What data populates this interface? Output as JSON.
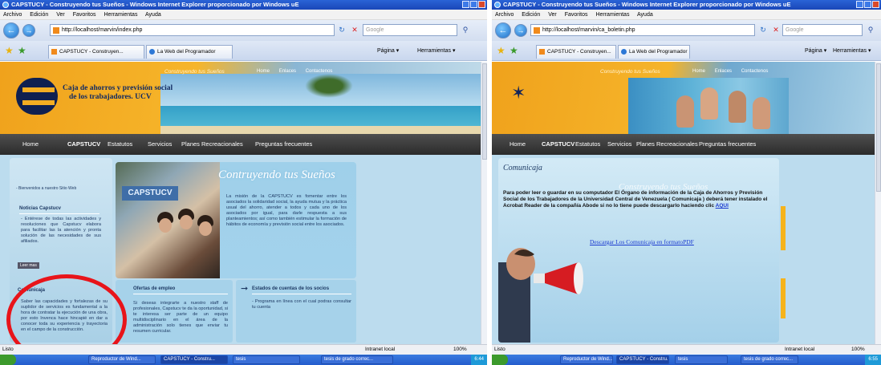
{
  "left": {
    "title": "CAPSTUCY - Construyendo tus Sueños - Windows Internet Explorer proporcionado por Windows uE",
    "menu": [
      "Archivo",
      "Edición",
      "Ver",
      "Favoritos",
      "Herramientas",
      "Ayuda"
    ],
    "address": "http://localhost/marvin/index.php",
    "search_placeholder": "Google",
    "tabs": [
      "CAPSTUCY - Construyen...",
      "La Web del Programador"
    ],
    "tools": [
      "Página ▾",
      "Herramientas ▾"
    ],
    "page": {
      "tagline": "Construyendo tus Sueños",
      "top_links": [
        "Home",
        "Enlaces",
        "Contactenos"
      ],
      "org_name_line1": "Caja de ahorros y previsión social",
      "org_name_line2": "de los trabajadores. UCV",
      "nav": [
        "Home",
        "CAPSTUCV",
        "Estatutos",
        "Servicios",
        "Planes Recreacionales",
        "Preguntas frecuentes"
      ],
      "welcome": "- Bienvenidos a nuestro Sitio Web",
      "news_title": "Noticias Capstucv",
      "news_text": "- Entérese de todas las actividades y resoluciones que Capstucv elabora para facilitar las la atención y pronta solución de las necesidades de sus afiliados.",
      "more": "Leer mas",
      "feature_title": "Contruyendo tus Sueños",
      "sign_text": "CAPSTUCV",
      "feature_text": "La misión de la CAPSTUCV es fomentar entre los asociados la solidaridad social, la ayuda mutua y la práctica usual del ahorro, atender a todos y cada uno de los asociados por igual, para darle respuesta a sus planteamientos; así como también estimular la formación de hábitos de economía y previsión social entre los asociados.",
      "comunicaja_title": "Comunicaja",
      "comunicaja_text": "Saber las capacidades y fortalezas de su suplidor de servicios es fundamental a la hora de contratar la ejecución de una obra, por esto Invenca hace hincapié en dar a conocer toda su experiencia y trayectoria en el campo de la construcción.",
      "ofertas_title": "Ofertas de empleo",
      "ofertas_text": "Si deseas integrarte a nuestro staff de profesionales, Capstucv te da la oportunidad, si te interesa ser parte de un equipo multidisciplinario en el área de la administración solo tienes que enviar tu resumen curricular.",
      "estados_title": "Estados de cuentas de los socios",
      "estados_text": "- Programa en línea con el cual podras consultar tu cuenta"
    },
    "status": "Listo",
    "zone": "Intranet local",
    "zoom": "100%",
    "taskbar": [
      "Reproductor de Wind...",
      "CAPSTUCY - Constru...",
      "tesis",
      "tesis de grado correc..."
    ],
    "clock": "6:44"
  },
  "right": {
    "title": "CAPSTUCY - Construyendo tus Sueños - Windows Internet Explorer proporcionado por Windows uE",
    "menu": [
      "Archivo",
      "Edición",
      "Ver",
      "Favoritos",
      "Herramientas",
      "Ayuda"
    ],
    "address": "http://localhost/marvin/ca_boletin.php",
    "search_placeholder": "Google",
    "tabs": [
      "CAPSTUCY - Construyen...",
      "La Web del Programador"
    ],
    "tools": [
      "Página ▾",
      "Herramientas ▾"
    ],
    "page": {
      "tagline": "Construyendo tus Sueños",
      "top_links": [
        "Home",
        "Enlaces",
        "Contactenos"
      ],
      "nav": [
        "Home",
        "CAPSTUCV",
        "Estatutos",
        "Servicios",
        "Planes Recreacionales",
        "Preguntas frecuentes"
      ],
      "title": "Comunicaja",
      "ghost_title": "Construyendo tus Sueños",
      "text_before": "Para poder leer o guardar en su computador El Órgano de información de la Caja de Ahorros y Previsión Social de los Trabajadores de la Universidad Central de Venezuela ( Comunicaja ) deberá tener instalado el Acrobat Reader de la compañía Abode si no lo tiene puede descargarlo haciendo clic",
      "aqui": "AQUI",
      "download": "Descargar Los Comunicaja en formatoPDF"
    },
    "status": "Listo",
    "zone": "Intranet local",
    "zoom": "100%",
    "taskbar": [
      "Reproductor de Wind...",
      "CAPSTUCY - Constru...",
      "tesis",
      "tesis de grado correc..."
    ],
    "clock": "6:55"
  }
}
